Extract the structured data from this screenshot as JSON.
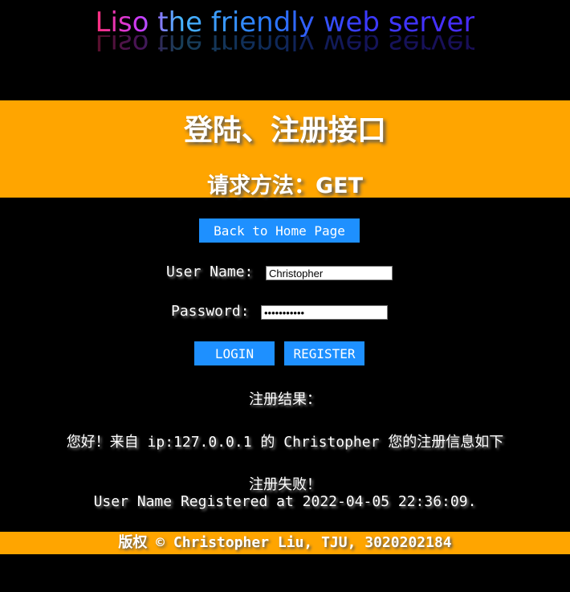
{
  "logo": {
    "text": "Liso the friendly web server"
  },
  "banner": {
    "title": "登陆、注册接口",
    "subtitle": "请求方法：GET"
  },
  "nav": {
    "back_home_label": "Back to Home Page"
  },
  "form": {
    "username_label": "User Name:",
    "username_value": "Christopher",
    "password_label": "Password:",
    "password_value": "•••••••••••",
    "login_label": "LOGIN",
    "register_label": "REGISTER"
  },
  "result": {
    "heading": "注册结果：",
    "greeting": "您好！来自 ip:127.0.0.1 的 Christopher 您的注册信息如下",
    "status": "注册失败！",
    "detail": "User Name Registered at 2022-04-05 22:36:09."
  },
  "footer": {
    "copyright": "版权 © Christopher Liu, TJU, 3020202184"
  },
  "colors": {
    "accent_orange": "#ffa500",
    "button_blue": "#1e90ff",
    "background": "#000000"
  }
}
